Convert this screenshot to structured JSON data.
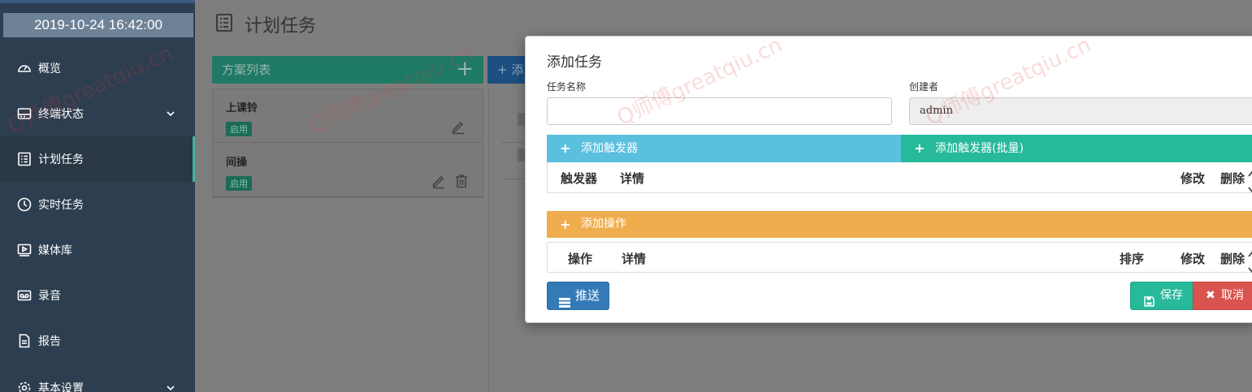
{
  "sidebar": {
    "clock": "2019-10-24 16:42:00",
    "items": [
      {
        "label": "概览",
        "icon": "dashboard-icon"
      },
      {
        "label": "终端状态",
        "icon": "terminal-icon",
        "has_chevron": true
      },
      {
        "label": "计划任务",
        "icon": "checklist-icon",
        "active": true
      },
      {
        "label": "实时任务",
        "icon": "clock-icon"
      },
      {
        "label": "媒体库",
        "icon": "media-icon"
      },
      {
        "label": "录音",
        "icon": "voicemail-icon"
      },
      {
        "label": "报告",
        "icon": "report-icon"
      },
      {
        "label": "基本设置",
        "icon": "settings-icon",
        "has_chevron": true
      }
    ]
  },
  "page": {
    "title": "计划任务",
    "plan_list_label": "方案列表",
    "plan_list_add": "+",
    "add_button_partial": "+ 添",
    "plans": [
      {
        "name": "上课铃",
        "status": "启用"
      },
      {
        "name": "间操",
        "status": "启用"
      }
    ]
  },
  "modal": {
    "title": "添加任务",
    "task_name_label": "任务名称",
    "task_name_value": "",
    "creator_label": "创建者",
    "creator_value": "admin",
    "add_trigger": "添加触发器",
    "add_trigger_batch": "添加触发器(批量)",
    "trigger_table": {
      "columns": [
        "触发器",
        "详情",
        "修改",
        "删除"
      ]
    },
    "add_action": "添加操作",
    "action_table": {
      "columns": [
        "操作",
        "详情",
        "排序",
        "修改",
        "删除"
      ]
    },
    "push_button": "推送",
    "save_button": "保存",
    "cancel_button": "取消"
  },
  "watermark": "Q师傅greatqiu.cn",
  "colors": {
    "sidebar_bg": "#2d3e50",
    "accent_green": "#26b99a",
    "trigger_blue": "#5bc0de",
    "action_orange": "#f0ad4e",
    "primary_blue": "#337ab7",
    "danger_red": "#d9534f"
  }
}
